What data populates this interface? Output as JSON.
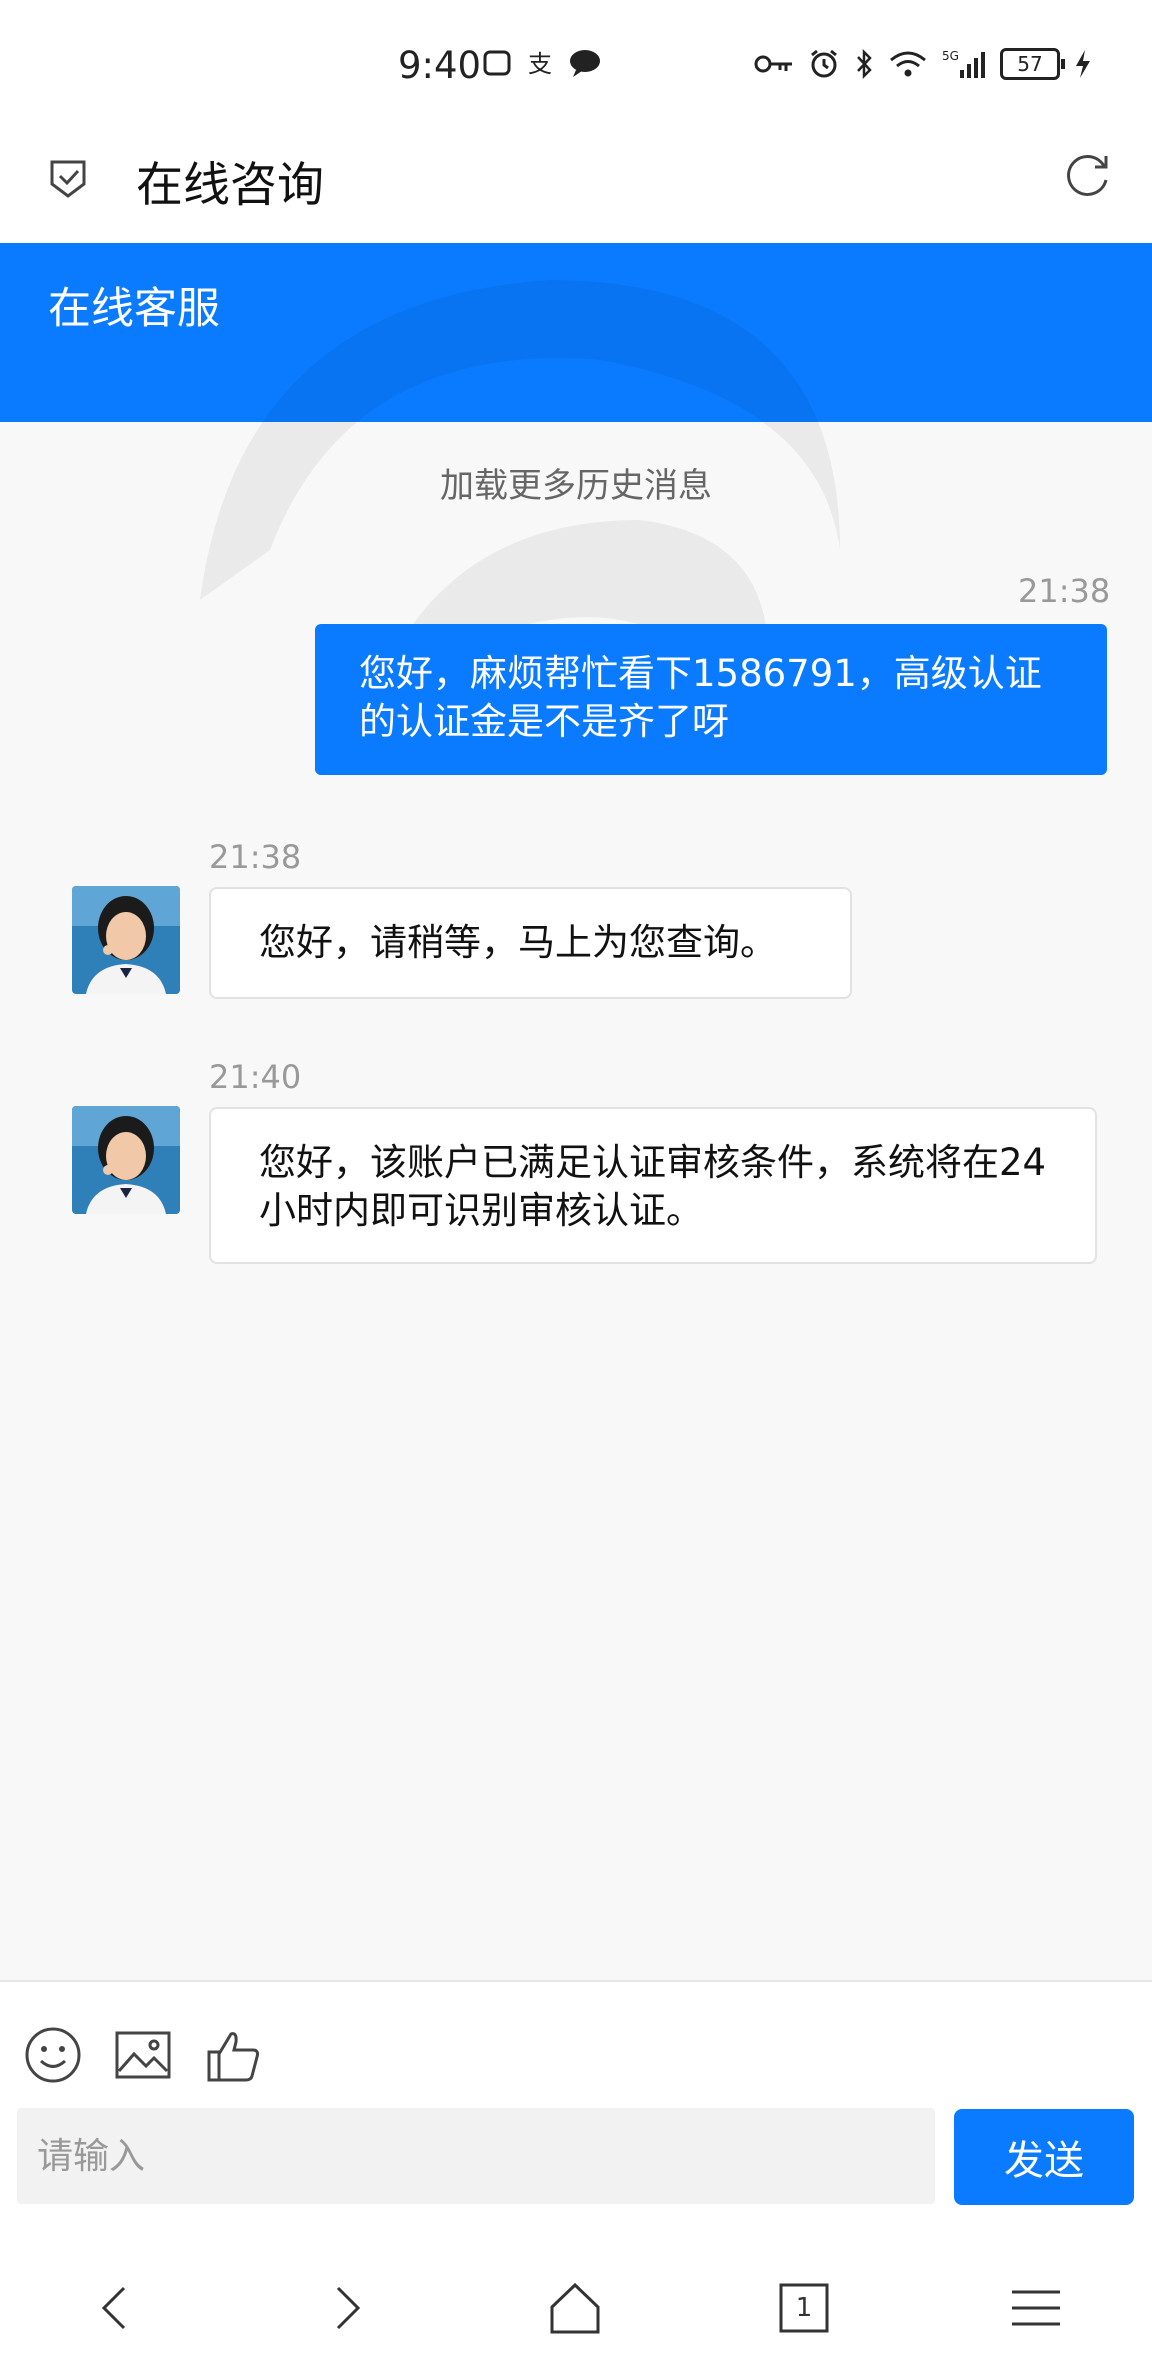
{
  "status_bar": {
    "time": "9:40",
    "battery": "57"
  },
  "nav": {
    "title": "在线咨询"
  },
  "header": {
    "title": "在线客服"
  },
  "chat": {
    "load_more": "加载更多历史消息",
    "messages": [
      {
        "from": "user",
        "time": "21:38",
        "text": "您好，麻烦帮忙看下1586791，高级认证的认证金是不是齐了呀"
      },
      {
        "from": "agent",
        "time": "21:38",
        "text": "您好，请稍等，马上为您查询。"
      },
      {
        "from": "agent",
        "time": "21:40",
        "text": "您好，该账户已满足认证审核条件，系统将在24小时内即可识别审核认证。"
      }
    ]
  },
  "input": {
    "placeholder": "请输入",
    "send_label": "发送"
  },
  "bottom_nav": {
    "tab_count": "1"
  },
  "icons": {
    "toolbar": [
      "emoji-icon",
      "image-icon",
      "thumbs-up-icon"
    ],
    "bottom": [
      "back-arrow-icon",
      "forward-arrow-icon",
      "home-icon",
      "tabs-icon",
      "menu-icon"
    ]
  },
  "colors": {
    "accent": "#0a7bff",
    "background": "#f8f8f8"
  }
}
